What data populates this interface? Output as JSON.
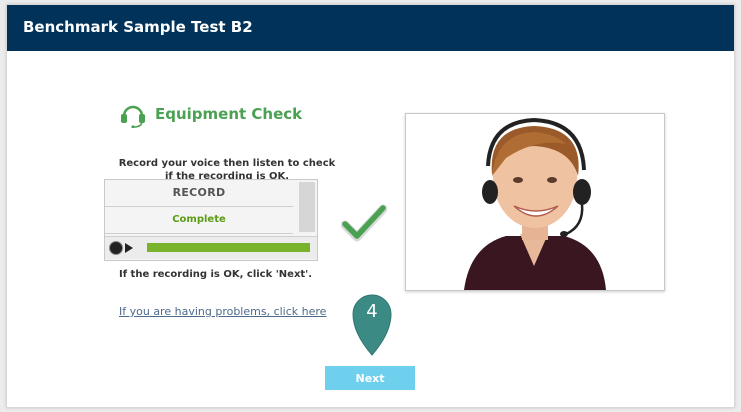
{
  "header": {
    "title": "Benchmark Sample Test B2"
  },
  "equipment": {
    "heading": "Equipment Check",
    "instruction_line1": "Record your voice then listen to check",
    "instruction_line2": "if the recording is OK.",
    "record_label": "RECORD",
    "status_label": "Complete",
    "progress_fraction": 1.0,
    "ok_message": "If the recording is OK, click 'Next'.",
    "help_link": "If you are having problems, click here"
  },
  "step": {
    "number": "4"
  },
  "footer": {
    "next_label": "Next"
  },
  "icons": [
    "headset-icon",
    "checkmark-icon",
    "record-icon",
    "play-icon",
    "location-pin-icon"
  ],
  "colors": {
    "header": "#00325a",
    "accent_green": "#4aa151",
    "next_button": "#6ed0ec",
    "pin": "#3b8a84"
  }
}
